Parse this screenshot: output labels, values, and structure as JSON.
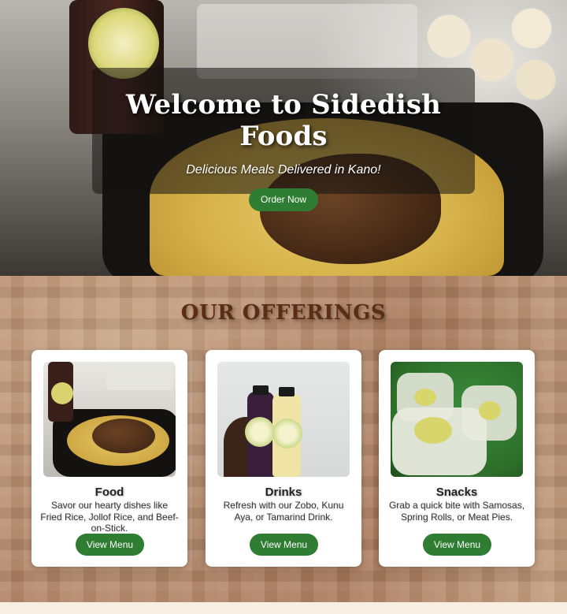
{
  "hero": {
    "title": "Welcome to Sidedish Foods",
    "subtitle": "Delicious Meals Delivered in Kano!",
    "order_button": "Order Now"
  },
  "offerings": {
    "heading": "OUR OFFERINGS",
    "cards": [
      {
        "name": "Food",
        "description": "Savor our hearty dishes like Fried Rice, Jollof Rice, and Beef-on-Stick.",
        "button": "View Menu",
        "image": "food-tray-image"
      },
      {
        "name": "Drinks",
        "description": "Refresh with our Zobo, Kunu Aya, or Tamarind Drink.",
        "button": "View Menu",
        "image": "drink-bottles-image"
      },
      {
        "name": "Snacks",
        "description": "Grab a quick bite with Samosas, Spring Rolls, or Meat Pies.",
        "button": "View Menu",
        "image": "snack-containers-image"
      }
    ]
  },
  "colors": {
    "button_green": "#2e7d32",
    "heading_brown": "#5a2d14",
    "card_bg": "#ffffff"
  }
}
